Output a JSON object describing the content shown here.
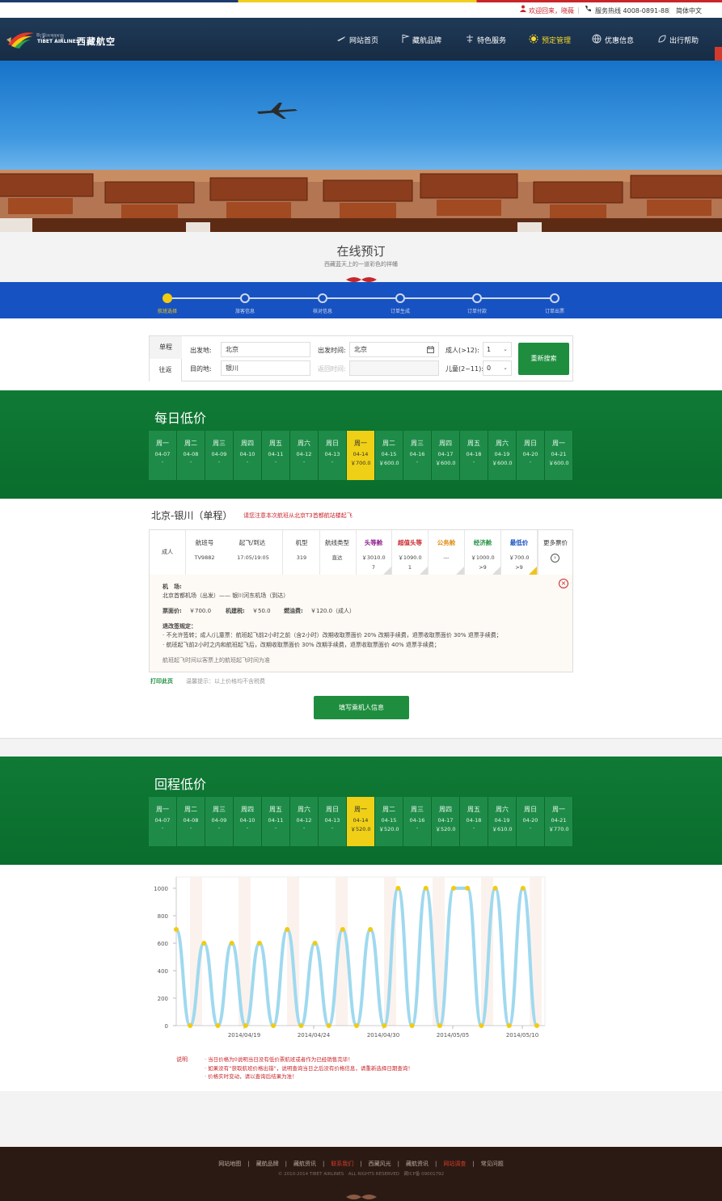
{
  "topbar": {
    "welcome": "欢迎回来，晓薇",
    "hotline": "服务热线 4008-0891-88",
    "language": "简体中文"
  },
  "header": {
    "logo_tibetan": "བོད་ལྗོངས་གནམ་གྲུ།",
    "logo_en": "TIBET AIRLINES",
    "logo_cn": "西藏航空",
    "nav": [
      "网站首页",
      "藏航品牌",
      "特色服务",
      "预定管理",
      "优惠信息",
      "出行帮助"
    ],
    "active_nav": "预定管理"
  },
  "booking": {
    "title": "在线预订",
    "subtitle": "西藏蓝天上的一道彩色的祥幡"
  },
  "steps": [
    "航班选择",
    "旅客信息",
    "核对信息",
    "订单生成",
    "订单付款",
    "订单出票"
  ],
  "search": {
    "tab_single": "单程",
    "tab_round": "往返",
    "from_label": "出发地:",
    "from_value": "北京",
    "to_label": "目的地:",
    "to_value": "银川",
    "depart_label": "出发时间:",
    "depart_value": "北京",
    "return_label": "返回时间:",
    "adult_label": "成人(>12):",
    "adult_value": "1",
    "child_label": "儿童(2~11):",
    "child_value": "0",
    "button": "重新搜索"
  },
  "daily": {
    "title": "每日低价",
    "days": [
      {
        "w": "周一",
        "d": "04-07",
        "p": "-"
      },
      {
        "w": "周二",
        "d": "04-08",
        "p": "-"
      },
      {
        "w": "周三",
        "d": "04-09",
        "p": "-"
      },
      {
        "w": "周四",
        "d": "04-10",
        "p": "-"
      },
      {
        "w": "周五",
        "d": "04-11",
        "p": "-"
      },
      {
        "w": "周六",
        "d": "04-12",
        "p": "-"
      },
      {
        "w": "周日",
        "d": "04-13",
        "p": "-"
      },
      {
        "w": "周一",
        "d": "04-14",
        "p": "￥700.0",
        "sel": true
      },
      {
        "w": "周二",
        "d": "04-15",
        "p": "￥600.0"
      },
      {
        "w": "周三",
        "d": "04-16",
        "p": "-"
      },
      {
        "w": "周四",
        "d": "04-17",
        "p": "￥600.0"
      },
      {
        "w": "周五",
        "d": "04-18",
        "p": "-"
      },
      {
        "w": "周六",
        "d": "04-19",
        "p": "￥600.0"
      },
      {
        "w": "周日",
        "d": "04-20",
        "p": "-"
      },
      {
        "w": "周一",
        "d": "04-21",
        "p": "￥600.0"
      }
    ]
  },
  "route": {
    "title": "北京-银川（单程）",
    "note": "请您注意本次航班从北京T3首都航站楼起飞"
  },
  "flight": {
    "passenger": "成人",
    "headers": [
      "航班号",
      "起飞/到达",
      "机型",
      "航线类型"
    ],
    "values": [
      "TV9882",
      "17:05/19:05",
      "319",
      "直达"
    ],
    "fares": [
      {
        "name": "头等舱",
        "price": "￥3010.0",
        "extra": "7",
        "color": "#8b1a8b"
      },
      {
        "name": "超值头等",
        "price": "￥1090.0",
        "extra": "1",
        "color": "#c8262b"
      },
      {
        "name": "公务舱",
        "price": "---",
        "extra": "",
        "color": "#e08b12"
      },
      {
        "name": "经济舱",
        "price": "￥1000.0",
        "extra": ">9",
        "color": "#1e8e3e"
      },
      {
        "name": "最低价",
        "price": "￥700.0",
        "extra": ">9",
        "color": "#1752c2"
      }
    ],
    "more": "更多票价"
  },
  "detail": {
    "airport_label": "机　场:",
    "airport_value": "北京首都机场（出发）—— 银川河东机场（到达）",
    "fare_label": "票面价:",
    "fare_value": "￥700.0",
    "tax_label": "机建税:",
    "tax_value": "￥50.0",
    "fuel_label": "燃油费:",
    "fuel_value": "￥120.0（成人）",
    "rules_label": "退改签规定：",
    "rule1": "· 不允许签转；成人/儿童票：航班起飞前2小时之前（含2小时）改期收取票面价 20% 改期手续费，退票收取票面价 30% 退票手续费；",
    "rule2": "· 航班起飞前2小时之内和航班起飞后，改期收取票面价 30% 改期手续费，退票收取票面价 40% 退票手续费；",
    "footnote": "航班起飞时间以客票上的航班起飞时间为准"
  },
  "actions": {
    "print": "打印此页",
    "print_note": "温馨提示：以上价格均不含税费",
    "fill_button": "填写乘机人信息"
  },
  "return_band": {
    "title": "回程低价",
    "days": [
      {
        "w": "周一",
        "d": "04-07",
        "p": "-"
      },
      {
        "w": "周二",
        "d": "04-08",
        "p": "-"
      },
      {
        "w": "周三",
        "d": "04-09",
        "p": "-"
      },
      {
        "w": "周四",
        "d": "04-10",
        "p": "-"
      },
      {
        "w": "周五",
        "d": "04-11",
        "p": "-"
      },
      {
        "w": "周六",
        "d": "04-12",
        "p": "-"
      },
      {
        "w": "周日",
        "d": "04-13",
        "p": "-"
      },
      {
        "w": "周一",
        "d": "04-14",
        "p": "￥520.0",
        "sel": true
      },
      {
        "w": "周二",
        "d": "04-15",
        "p": "￥520.0"
      },
      {
        "w": "周三",
        "d": "04-16",
        "p": "-"
      },
      {
        "w": "周四",
        "d": "04-17",
        "p": "￥520.0"
      },
      {
        "w": "周五",
        "d": "04-18",
        "p": "-"
      },
      {
        "w": "周六",
        "d": "04-19",
        "p": "￥610.0"
      },
      {
        "w": "周日",
        "d": "04-20",
        "p": "-"
      },
      {
        "w": "周一",
        "d": "04-21",
        "p": "￥770.0"
      }
    ]
  },
  "chart_data": {
    "type": "line",
    "title": "",
    "xlabel": "",
    "ylabel": "",
    "ylim": [
      0,
      1000
    ],
    "yticks": [
      0,
      200,
      400,
      600,
      800,
      1000
    ],
    "xtick_labels": [
      "2014/04/19",
      "2014/04/24",
      "2014/04/30",
      "2014/05/05",
      "2014/05/10"
    ],
    "grid": true,
    "series": [
      {
        "values": [
          700,
          0,
          600,
          0,
          600,
          0,
          600,
          0,
          700,
          0,
          600,
          0,
          700,
          0,
          700,
          0,
          1000,
          0,
          1000,
          0,
          1000,
          1000,
          0,
          1000,
          0,
          1000,
          0
        ]
      }
    ],
    "color": "#9fd9ef",
    "point_color": "#f2cb11"
  },
  "chart_notes": {
    "label": "说明",
    "lines": [
      "· 当日价格为0说明当日没有低价票航班或者作为已经销售完毕！",
      "· 如果没有“获取航班价格出错”，说明查询当日之后没有价格信息，请重新选择日期查询！",
      "· 价格实时变动，请以查询后结果为准！"
    ]
  },
  "footer": {
    "links": [
      "网站地图",
      "藏航品牌",
      "藏航资讯",
      "联系我们",
      "西藏风光",
      "藏航资讯",
      "网站调查",
      "常见问题"
    ],
    "highlight": [
      "联系我们",
      "网站调查"
    ],
    "copyright": "© 2010-2014 TIBET AIRLINES　ALL RIGHTS RESERVED　藏ICP备 09001792"
  }
}
